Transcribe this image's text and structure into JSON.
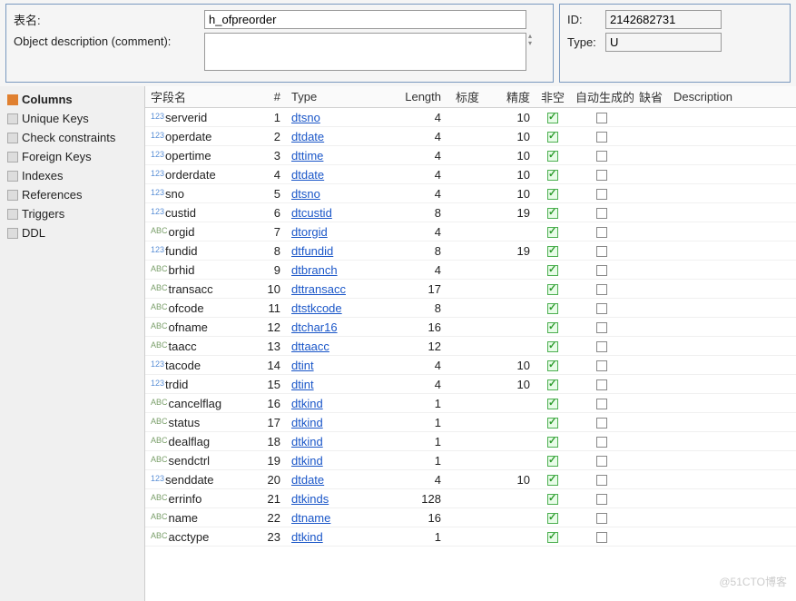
{
  "top": {
    "name_label": "表名:",
    "name_value": "h_ofpreorder",
    "desc_label": "Object description (comment):",
    "desc_value": "",
    "id_label": "ID:",
    "id_value": "2142682731",
    "type_label": "Type:",
    "type_value": "U"
  },
  "sidebar": {
    "items": [
      {
        "label": "Columns",
        "icon": "columns",
        "active": true
      },
      {
        "label": "Unique Keys",
        "icon": "key"
      },
      {
        "label": "Check constraints",
        "icon": "check"
      },
      {
        "label": "Foreign Keys",
        "icon": "fkey"
      },
      {
        "label": "Indexes",
        "icon": "index"
      },
      {
        "label": "References",
        "icon": "ref"
      },
      {
        "label": "Triggers",
        "icon": "trigger"
      },
      {
        "label": "DDL",
        "icon": "ddl"
      }
    ]
  },
  "grid": {
    "headers": {
      "name": "字段名",
      "num": "#",
      "type": "Type",
      "length": "Length",
      "scale": "标度",
      "precision": "精度",
      "notnull": "非空",
      "auto": "自动生成的",
      "default": "缺省",
      "desc": "Description"
    },
    "rows": [
      {
        "prefix": "123",
        "k": "num",
        "name": "serverid",
        "num": 1,
        "type": "dtsno",
        "len": 4,
        "prec": 10,
        "nn": true,
        "auto": false
      },
      {
        "prefix": "123",
        "k": "num",
        "name": "operdate",
        "num": 2,
        "type": "dtdate",
        "len": 4,
        "prec": 10,
        "nn": true,
        "auto": false
      },
      {
        "prefix": "123",
        "k": "num",
        "name": "opertime",
        "num": 3,
        "type": "dttime",
        "len": 4,
        "prec": 10,
        "nn": true,
        "auto": false
      },
      {
        "prefix": "123",
        "k": "num",
        "name": "orderdate",
        "num": 4,
        "type": "dtdate",
        "len": 4,
        "prec": 10,
        "nn": true,
        "auto": false
      },
      {
        "prefix": "123",
        "k": "num",
        "name": "sno",
        "num": 5,
        "type": "dtsno",
        "len": 4,
        "prec": 10,
        "nn": true,
        "auto": false
      },
      {
        "prefix": "123",
        "k": "num",
        "name": "custid",
        "num": 6,
        "type": "dtcustid",
        "len": 8,
        "prec": 19,
        "nn": true,
        "auto": false
      },
      {
        "prefix": "ABC",
        "k": "str",
        "name": "orgid",
        "num": 7,
        "type": "dtorgid",
        "len": 4,
        "prec": "",
        "nn": true,
        "auto": false
      },
      {
        "prefix": "123",
        "k": "num",
        "name": "fundid",
        "num": 8,
        "type": "dtfundid",
        "len": 8,
        "prec": 19,
        "nn": true,
        "auto": false
      },
      {
        "prefix": "ABC",
        "k": "str",
        "name": "brhid",
        "num": 9,
        "type": "dtbranch",
        "len": 4,
        "prec": "",
        "nn": true,
        "auto": false
      },
      {
        "prefix": "ABC",
        "k": "str",
        "name": "transacc",
        "num": 10,
        "type": "dttransacc",
        "len": 17,
        "prec": "",
        "nn": true,
        "auto": false
      },
      {
        "prefix": "ABC",
        "k": "str",
        "name": "ofcode",
        "num": 11,
        "type": "dtstkcode",
        "len": 8,
        "prec": "",
        "nn": true,
        "auto": false
      },
      {
        "prefix": "ABC",
        "k": "str",
        "name": "ofname",
        "num": 12,
        "type": "dtchar16",
        "len": 16,
        "prec": "",
        "nn": true,
        "auto": false
      },
      {
        "prefix": "ABC",
        "k": "str",
        "name": "taacc",
        "num": 13,
        "type": "dttaacc",
        "len": 12,
        "prec": "",
        "nn": true,
        "auto": false
      },
      {
        "prefix": "123",
        "k": "num",
        "name": "tacode",
        "num": 14,
        "type": "dtint",
        "len": 4,
        "prec": 10,
        "nn": true,
        "auto": false
      },
      {
        "prefix": "123",
        "k": "num",
        "name": "trdid",
        "num": 15,
        "type": "dtint",
        "len": 4,
        "prec": 10,
        "nn": true,
        "auto": false
      },
      {
        "prefix": "ABC",
        "k": "str",
        "name": "cancelflag",
        "num": 16,
        "type": "dtkind",
        "len": 1,
        "prec": "",
        "nn": true,
        "auto": false
      },
      {
        "prefix": "ABC",
        "k": "str",
        "name": "status",
        "num": 17,
        "type": "dtkind",
        "len": 1,
        "prec": "",
        "nn": true,
        "auto": false
      },
      {
        "prefix": "ABC",
        "k": "str",
        "name": "dealflag",
        "num": 18,
        "type": "dtkind",
        "len": 1,
        "prec": "",
        "nn": true,
        "auto": false
      },
      {
        "prefix": "ABC",
        "k": "str",
        "name": "sendctrl",
        "num": 19,
        "type": "dtkind",
        "len": 1,
        "prec": "",
        "nn": true,
        "auto": false
      },
      {
        "prefix": "123",
        "k": "num",
        "name": "senddate",
        "num": 20,
        "type": "dtdate",
        "len": 4,
        "prec": 10,
        "nn": true,
        "auto": false
      },
      {
        "prefix": "ABC",
        "k": "str",
        "name": "errinfo",
        "num": 21,
        "type": "dtkinds",
        "len": 128,
        "prec": "",
        "nn": true,
        "auto": false
      },
      {
        "prefix": "ABC",
        "k": "str",
        "name": "name",
        "num": 22,
        "type": "dtname",
        "len": 16,
        "prec": "",
        "nn": true,
        "auto": false
      },
      {
        "prefix": "ABC",
        "k": "str",
        "name": "acctype",
        "num": 23,
        "type": "dtkind",
        "len": 1,
        "prec": "",
        "nn": true,
        "auto": false
      }
    ]
  },
  "watermark": "@51CTO博客"
}
